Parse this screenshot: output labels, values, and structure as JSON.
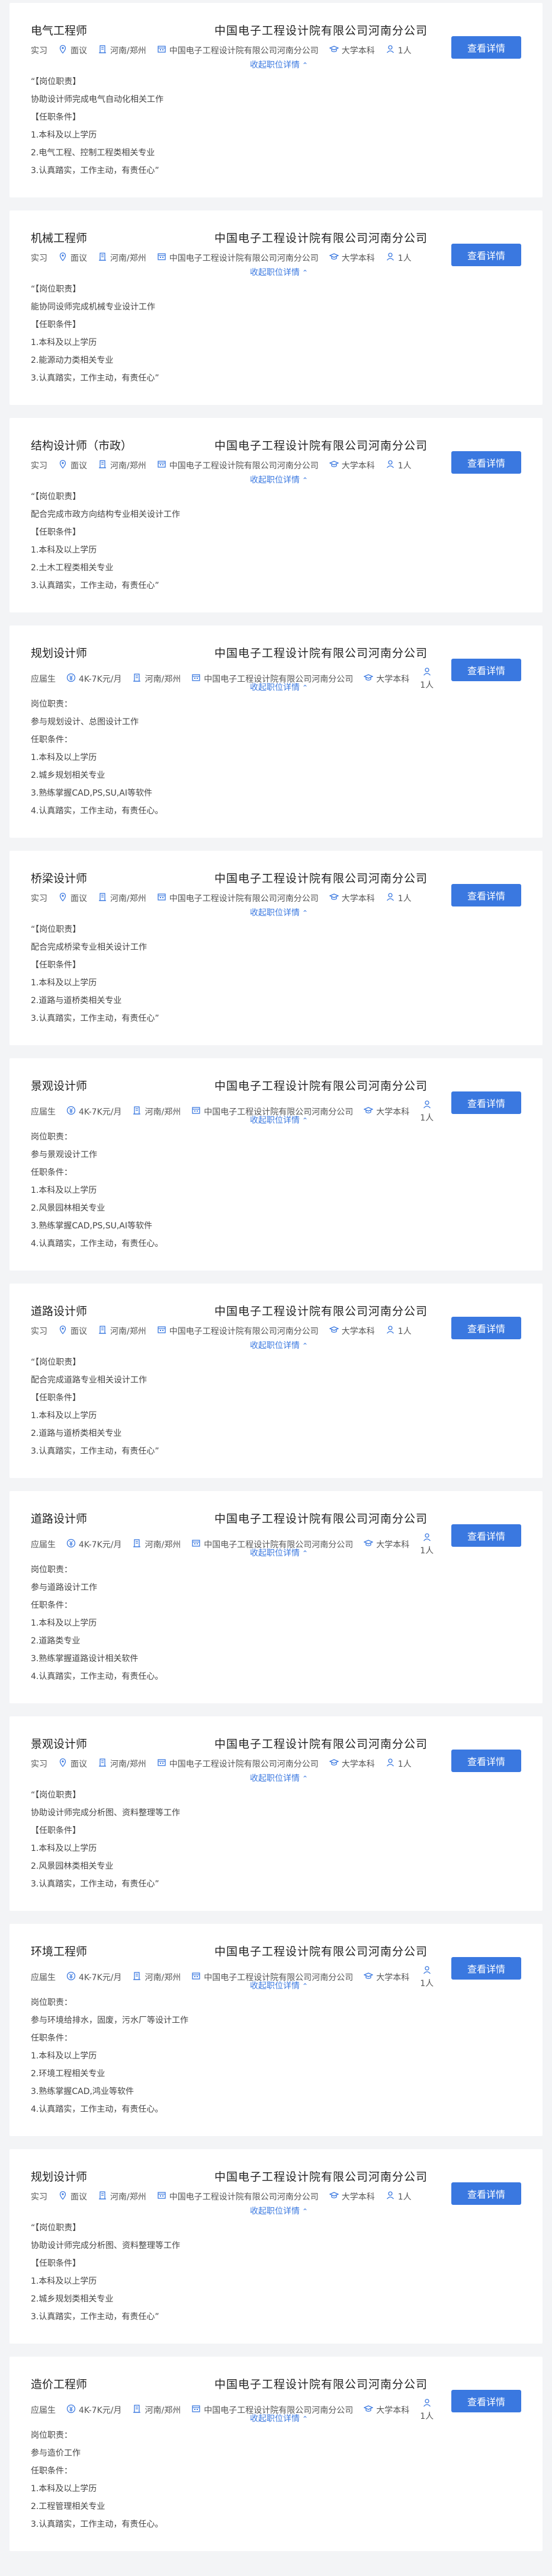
{
  "toggle_label": "收起职位详情",
  "detail_button_label": "查看详情",
  "colors": {
    "accent": "#3a78e0",
    "background": "#f3f4f6",
    "card": "#ffffff"
  },
  "jobs": [
    {
      "title": "电气工程师",
      "company": "中国电子工程设计院有限公司河南分公司",
      "pay": "实习",
      "pay_type": "internship",
      "salary": "面议",
      "location": "河南/郑州",
      "org": "中国电子工程设计院有限公司河南分公司",
      "education": "大学本科",
      "headcount": "1人",
      "desc": [
        "“【岗位职责】",
        "协助设计师完成电气自动化相关工作",
        "【任职条件】",
        "1.本科及以上学历",
        "2.电气工程、控制工程类相关专业",
        "3.认真踏实，工作主动，有责任心”"
      ]
    },
    {
      "title": "机械工程师",
      "company": "中国电子工程设计院有限公司河南分公司",
      "pay": "实习",
      "pay_type": "internship",
      "salary": "面议",
      "location": "河南/郑州",
      "org": "中国电子工程设计院有限公司河南分公司",
      "education": "大学本科",
      "headcount": "1人",
      "desc": [
        "“【岗位职责】",
        "能协同设师完成机械专业设计工作",
        "【任职条件】",
        "1.本科及以上学历",
        "2.能源动力类相关专业",
        "3.认真踏实，工作主动，有责任心”"
      ]
    },
    {
      "title": "结构设计师（市政）",
      "company": "中国电子工程设计院有限公司河南分公司",
      "pay": "实习",
      "pay_type": "internship",
      "salary": "面议",
      "location": "河南/郑州",
      "org": "中国电子工程设计院有限公司河南分公司",
      "education": "大学本科",
      "headcount": "1人",
      "desc": [
        "“【岗位职责】",
        "配合完成市政方向结构专业相关设计工作",
        "【任职条件】",
        "1.本科及以上学历",
        "2.土木工程类相关专业",
        "3.认真踏实，工作主动，有责任心”"
      ]
    },
    {
      "title": "规划设计师",
      "company": "中国电子工程设计院有限公司河南分公司",
      "pay": "应届生",
      "pay_type": "salary",
      "salary": "4K-7K元/月",
      "location": "河南/郑州",
      "org": "中国电子工程设计院有限公司河南分公司",
      "education": "大学本科",
      "headcount": "1人",
      "desc": [
        "岗位职责：",
        "参与规划设计、总图设计工作",
        "任职条件：",
        "1.本科及以上学历",
        "2.城乡规划相关专业",
        "3.熟练掌握CAD,PS,SU,AI等软件",
        "4.认真踏实，工作主动，有责任心。"
      ]
    },
    {
      "title": "桥梁设计师",
      "company": "中国电子工程设计院有限公司河南分公司",
      "pay": "实习",
      "pay_type": "internship",
      "salary": "面议",
      "location": "河南/郑州",
      "org": "中国电子工程设计院有限公司河南分公司",
      "education": "大学本科",
      "headcount": "1人",
      "desc": [
        "“【岗位职责】",
        "配合完成桥梁专业相关设计工作",
        "【任职条件】",
        "1.本科及以上学历",
        "2.道路与道桥类相关专业",
        "3.认真踏实，工作主动，有责任心”"
      ]
    },
    {
      "title": "景观设计师",
      "company": "中国电子工程设计院有限公司河南分公司",
      "pay": "应届生",
      "pay_type": "salary",
      "salary": "4K-7K元/月",
      "location": "河南/郑州",
      "org": "中国电子工程设计院有限公司河南分公司",
      "education": "大学本科",
      "headcount": "1人",
      "desc": [
        "岗位职责：",
        "参与景观设计工作",
        "任职条件：",
        "1.本科及以上学历",
        "2.风景园林相关专业",
        "3.熟练掌握CAD,PS,SU,AI等软件",
        "4.认真踏实，工作主动，有责任心。"
      ]
    },
    {
      "title": "道路设计师",
      "company": "中国电子工程设计院有限公司河南分公司",
      "pay": "实习",
      "pay_type": "internship",
      "salary": "面议",
      "location": "河南/郑州",
      "org": "中国电子工程设计院有限公司河南分公司",
      "education": "大学本科",
      "headcount": "1人",
      "desc": [
        "“【岗位职责】",
        "配合完成道路专业相关设计工作",
        "【任职条件】",
        "1.本科及以上学历",
        "2.道路与道桥类相关专业",
        "3.认真踏实，工作主动，有责任心”"
      ]
    },
    {
      "title": "道路设计师",
      "company": "中国电子工程设计院有限公司河南分公司",
      "pay": "应届生",
      "pay_type": "salary",
      "salary": "4K-7K元/月",
      "location": "河南/郑州",
      "org": "中国电子工程设计院有限公司河南分公司",
      "education": "大学本科",
      "headcount": "1人",
      "desc": [
        "岗位职责：",
        "参与道路设计工作",
        "任职条件：",
        "1.本科及以上学历",
        "2.道路类专业",
        "3.熟练掌握道路设计相关软件",
        "4.认真踏实，工作主动，有责任心。"
      ]
    },
    {
      "title": "景观设计师",
      "company": "中国电子工程设计院有限公司河南分公司",
      "pay": "实习",
      "pay_type": "internship",
      "salary": "面议",
      "location": "河南/郑州",
      "org": "中国电子工程设计院有限公司河南分公司",
      "education": "大学本科",
      "headcount": "1人",
      "desc": [
        "“【岗位职责】",
        "协助设计师完成分析图、资料整理等工作",
        "【任职条件】",
        "1.本科及以上学历",
        "2.风景园林类相关专业",
        "3.认真踏实，工作主动，有责任心”"
      ]
    },
    {
      "title": "环境工程师",
      "company": "中国电子工程设计院有限公司河南分公司",
      "pay": "应届生",
      "pay_type": "salary",
      "salary": "4K-7K元/月",
      "location": "河南/郑州",
      "org": "中国电子工程设计院有限公司河南分公司",
      "education": "大学本科",
      "headcount": "1人",
      "desc": [
        "岗位职责：",
        "参与环境给排水，固废，污水厂等设计工作",
        "任职条件：",
        "1.本科及以上学历",
        "2.环境工程相关专业",
        "3.熟练掌握CAD,鸿业等软件",
        "4.认真踏实，工作主动，有责任心。"
      ]
    },
    {
      "title": "规划设计师",
      "company": "中国电子工程设计院有限公司河南分公司",
      "pay": "实习",
      "pay_type": "internship",
      "salary": "面议",
      "location": "河南/郑州",
      "org": "中国电子工程设计院有限公司河南分公司",
      "education": "大学本科",
      "headcount": "1人",
      "desc": [
        "“【岗位职责】",
        "协助设计师完成分析图、资料整理等工作",
        "【任职条件】",
        "1.本科及以上学历",
        "2.城乡规划类相关专业",
        "3.认真踏实，工作主动，有责任心”"
      ]
    },
    {
      "title": "造价工程师",
      "company": "中国电子工程设计院有限公司河南分公司",
      "pay": "应届生",
      "pay_type": "salary",
      "salary": "4K-7K元/月",
      "location": "河南/郑州",
      "org": "中国电子工程设计院有限公司河南分公司",
      "education": "大学本科",
      "headcount": "1人",
      "desc": [
        "岗位职责：",
        "参与造价工作",
        "任职条件：",
        "1.本科及以上学历",
        "2.工程管理相关专业",
        "3.认真踏实，工作主动，有责任心。"
      ]
    }
  ]
}
